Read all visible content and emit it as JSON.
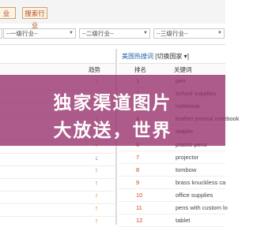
{
  "toolbar": {
    "left_button": "业",
    "search_button": "搜索行业"
  },
  "filters": [
    {
      "label": ""
    },
    {
      "label": "--一级行业--"
    },
    {
      "label": "--二级行业--"
    },
    {
      "label": "--三级行业--"
    },
    {
      "label": "--四级行业--"
    }
  ],
  "left_table": {
    "trend_header": "趋势",
    "trends": [
      "up",
      "up",
      "up",
      "up",
      "up",
      "up",
      "down",
      "up",
      "up",
      "up",
      "up",
      "up"
    ]
  },
  "right_panel": {
    "title_prefix": "美国热搜词",
    "title_suffix": "[切换国家 ▾]",
    "rank_header": "排名",
    "keyword_header": "关键词",
    "rows": [
      {
        "rank": "1",
        "keyword": "pen"
      },
      {
        "rank": "2",
        "keyword": "school supplies"
      },
      {
        "rank": "3",
        "keyword": "notebook"
      },
      {
        "rank": "4",
        "keyword": "leather journal notebook"
      },
      {
        "rank": "5",
        "keyword": "stapler"
      },
      {
        "rank": "6",
        "keyword": "plastic pens"
      },
      {
        "rank": "7",
        "keyword": "projector"
      },
      {
        "rank": "8",
        "keyword": "tombow"
      },
      {
        "rank": "9",
        "keyword": "brass knuckless ca"
      },
      {
        "rank": "10",
        "keyword": "office supplies"
      },
      {
        "rank": "11",
        "keyword": "pens with custom lo"
      },
      {
        "rank": "12",
        "keyword": "tablet"
      }
    ]
  },
  "overlay": {
    "line1": "独家渠道图片",
    "line2": "大放送，世界"
  }
}
